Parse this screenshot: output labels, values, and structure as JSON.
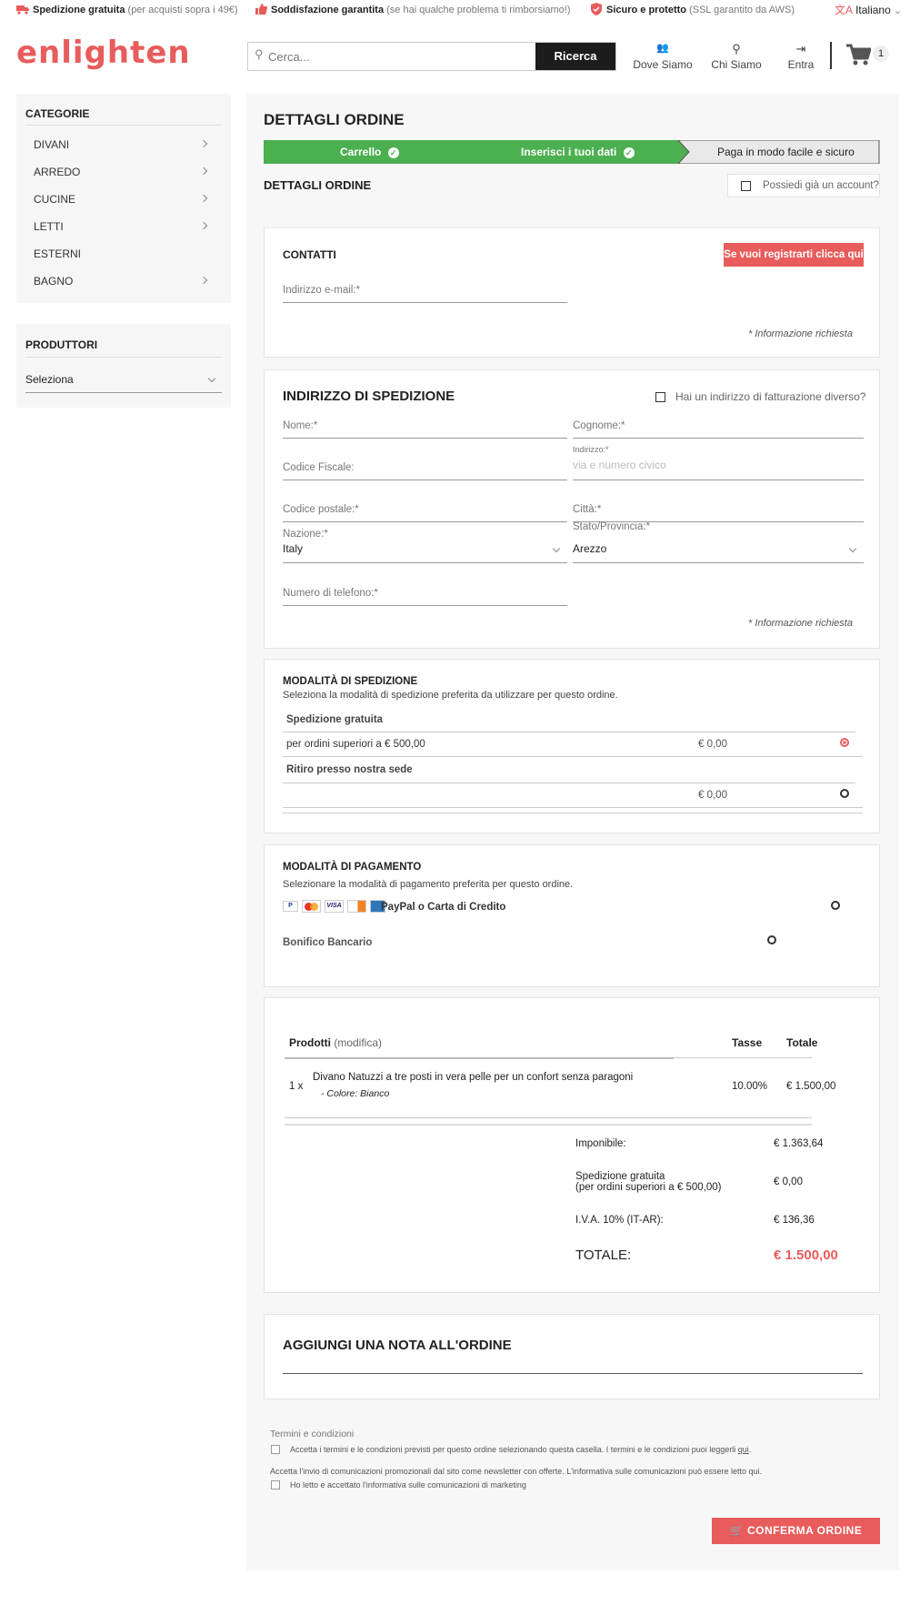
{
  "topbar": {
    "item1_bold": "Spedizione gratuita",
    "item1_rest": "(per acquisti sopra i 49€)",
    "item2_bold": "Soddisfazione garantita",
    "item2_rest": "(se hai qualche problema ti rimborsiamo!)",
    "item3_bold": "Sicuro e protetto",
    "item3_rest": "(SSL garantito da AWS)",
    "language": "Italiano"
  },
  "header": {
    "logo": "enlighten",
    "search_placeholder": "Cerca...",
    "search_button": "Ricerca",
    "nav_dove": "Dove Siamo",
    "nav_chi": "Chi Siamo",
    "nav_entra": "Entra",
    "cart_count": "1"
  },
  "sidebar": {
    "categories_title": "CATEGORIE",
    "items": [
      {
        "label": "DIVANI"
      },
      {
        "label": "ARREDO"
      },
      {
        "label": "CUCINE"
      },
      {
        "label": "LETTI"
      },
      {
        "label": "ESTERNI"
      },
      {
        "label": "BAGNO"
      }
    ],
    "producers_title": "PRODUTTORI",
    "producers_select": "Seleziona"
  },
  "main": {
    "title": "DETTAGLI ORDINE",
    "steps": {
      "s1": "Carrello",
      "s2": "Inserisci i tuoi dati",
      "s3": "Paga in modo facile e sicuro"
    },
    "subtitle": "DETTAGLI ORDINE",
    "account_question": "Possiedi già un account?"
  },
  "contatti": {
    "title": "CONTATTI",
    "register_button": "Se vuoi registrarti clicca qui",
    "email_label": "Indirizzo e-mail:*",
    "required_note": "* Informazione richiesta"
  },
  "spedizione": {
    "title": "INDIRIZZO DI SPEDIZIONE",
    "billing_question": "Hai un indirizzo di fatturazione diverso?",
    "nome": "Nome:*",
    "cognome": "Cognome:*",
    "codice_fiscale": "Codice Fiscale:",
    "indirizzo_label": "Indirizzo:*",
    "indirizzo_placeholder": "via e numero civico",
    "cap": "Codice postale:*",
    "citta": "Città:*",
    "nazione_label": "Nazione:*",
    "nazione_value": "Italy",
    "stato_label": "Stato/Provincia:*",
    "stato_value": "Arezzo",
    "telefono": "Numero di telefono:*",
    "required_note": "* Informazione richiesta"
  },
  "modalita_spedizione": {
    "title": "MODALITÀ DI SPEDIZIONE",
    "description": "Seleziona la modalità di spedizione preferita da utilizzare per questo ordine.",
    "options": [
      {
        "name": "Spedizione gratuita",
        "detail": "per ordini superiori a € 500,00",
        "price": "€ 0,00"
      },
      {
        "name": "Ritiro presso nostra sede",
        "detail": "",
        "price": "€ 0,00"
      }
    ]
  },
  "pagamento": {
    "title": "MODALITÀ DI PAGAMENTO",
    "description": "Selezionare la modalità di pagamento preferita per questo ordine.",
    "paypal": "PayPal o Carta di Credito",
    "bonifico": "Bonifico Bancario",
    "card_visa": "VISA"
  },
  "riepilogo": {
    "col_prodotti": "Prodotti",
    "col_modifica": "(modifica)",
    "col_tasse": "Tasse",
    "col_totale": "Totale",
    "qty": "1 x",
    "product": "Divano Natuzzi a tre posti in vera pelle per un confort senza paragoni",
    "variant": "- Colore: Bianco",
    "tax": "10.00%",
    "total": "€ 1.500,00",
    "imponibile_label": "Imponibile:",
    "imponibile_value": "€ 1.363,64",
    "sped_label1": "Spedizione gratuita",
    "sped_label2": "(per ordini superiori a € 500,00)",
    "sped_value": "€ 0,00",
    "iva_label": "I.V.A. 10% (IT-AR):",
    "iva_value": "€ 136,36",
    "totale_label": "TOTALE:",
    "totale_value": "€ 1.500,00"
  },
  "nota": {
    "title": "AGGIUNGI UNA NOTA ALL'ORDINE"
  },
  "termini": {
    "title": "Termini e condizioni",
    "accept_text": "Accetta i termini e le condizioni previsti per questo ordine selezionando questa casella. I termini e le condizioni puoi leggerli",
    "link": "qui",
    "promo_text": "Accetta l'invio di comunicazioni promozionali dal sito come newsletter con offerte. L'informativa sulle comunicazioni può essere letto",
    "promo_link": "qui",
    "marketing_text": "Ho letto e accettato l'informativa sulle comunicazioni di marketing"
  },
  "confirm_button": "CONFERMA ORDINE",
  "colors": {
    "accent": "#e85c5c",
    "green": "#4caf50",
    "dark": "#222222"
  }
}
